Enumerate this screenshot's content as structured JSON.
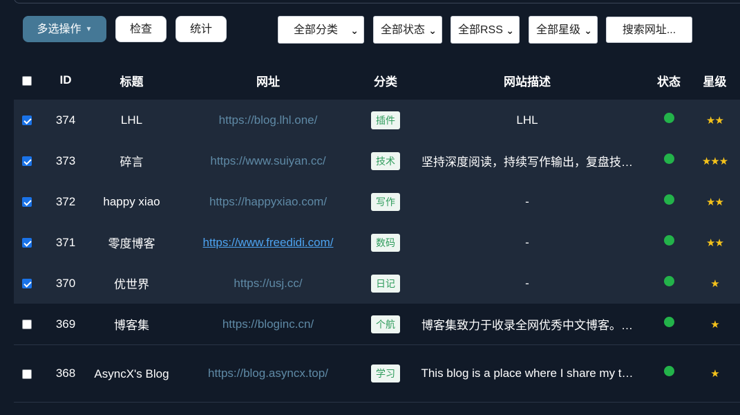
{
  "toolbar": {
    "multi_action_label": "多选操作",
    "check_label": "检查",
    "stats_label": "统计",
    "category_select": "全部分类",
    "status_select": "全部状态",
    "rss_select": "全部RSS",
    "stars_select": "全部星级",
    "search_label": "搜索网址..."
  },
  "table": {
    "headers": {
      "id": "ID",
      "title": "标题",
      "url": "网址",
      "category": "分类",
      "description": "网站描述",
      "status": "状态",
      "stars": "星级"
    },
    "rows": [
      {
        "checked": true,
        "id": "374",
        "title": "LHL",
        "url": "https://blog.lhl.one/",
        "category": "插件",
        "description": "LHL",
        "status": "online",
        "stars": "★★"
      },
      {
        "checked": true,
        "id": "373",
        "title": "碎言",
        "url": "https://www.suiyan.cc/",
        "category": "技术",
        "description": "坚持深度阅读，持续写作输出，复盘技…",
        "status": "online",
        "stars": "★★★"
      },
      {
        "checked": true,
        "id": "372",
        "title": "happy xiao",
        "url": "https://happyxiao.com/",
        "category": "写作",
        "description": "-",
        "status": "online",
        "stars": "★★"
      },
      {
        "checked": true,
        "id": "371",
        "title": "零度博客",
        "url": "https://www.freedidi.com/",
        "category": "数码",
        "description": "-",
        "status": "online",
        "stars": "★★",
        "url_active": true
      },
      {
        "checked": true,
        "id": "370",
        "title": "优世界",
        "url": "https://usj.cc/",
        "category": "日记",
        "description": "-",
        "status": "online",
        "stars": "★"
      },
      {
        "checked": false,
        "id": "369",
        "title": "博客集",
        "url": "https://bloginc.cn/",
        "category": "个航",
        "description": "博客集致力于收录全网优秀中文博客。…",
        "status": "online",
        "stars": "★"
      },
      {
        "checked": false,
        "id": "368",
        "title": "AsyncX's Blog",
        "url": "https://blog.asyncx.top/",
        "category": "学习",
        "description": "This blog is a place where I share my t…",
        "status": "online",
        "stars": "★"
      }
    ]
  }
}
